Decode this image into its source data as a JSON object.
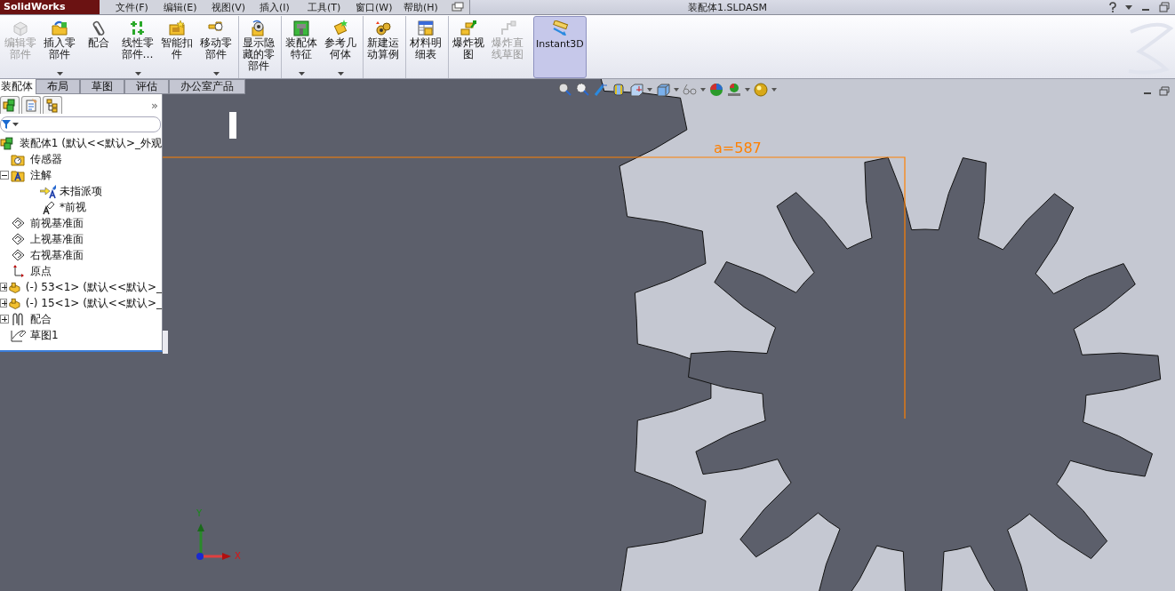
{
  "menu_bar": {
    "logo": "SolidWorks",
    "items": [
      "文件(F)",
      "编辑(E)",
      "视图(V)",
      "插入(I)",
      "工具(T)",
      "窗口(W)",
      "帮助(H)"
    ]
  },
  "window": {
    "title": "装配体1.SLDASM"
  },
  "command_manager": {
    "buttons": [
      {
        "label": "编辑零部件",
        "disabled": true,
        "dropdown": false,
        "selected": false,
        "separator_before": false
      },
      {
        "label": "插入零部件",
        "disabled": false,
        "dropdown": true,
        "selected": false,
        "separator_before": false
      },
      {
        "label": "配合",
        "disabled": false,
        "dropdown": false,
        "selected": false,
        "separator_before": false
      },
      {
        "label": "线性零部件…",
        "disabled": false,
        "dropdown": true,
        "selected": false,
        "separator_before": false
      },
      {
        "label": "智能扣件",
        "disabled": false,
        "dropdown": false,
        "selected": false,
        "separator_before": false
      },
      {
        "label": "移动零部件",
        "disabled": false,
        "dropdown": true,
        "selected": false,
        "separator_before": false
      },
      {
        "label": "显示隐藏的零部件",
        "disabled": false,
        "dropdown": false,
        "selected": false,
        "separator_before": true
      },
      {
        "label": "装配体特征",
        "disabled": false,
        "dropdown": true,
        "selected": false,
        "separator_before": true
      },
      {
        "label": "参考几何体",
        "disabled": false,
        "dropdown": true,
        "selected": false,
        "separator_before": false
      },
      {
        "label": "新建运动算例",
        "disabled": false,
        "dropdown": false,
        "selected": false,
        "separator_before": true
      },
      {
        "label": "材料明细表",
        "disabled": false,
        "dropdown": false,
        "selected": false,
        "separator_before": true
      },
      {
        "label": "爆炸视图",
        "disabled": false,
        "dropdown": false,
        "selected": false,
        "separator_before": true
      },
      {
        "label": "爆炸直线草图",
        "disabled": true,
        "dropdown": false,
        "selected": false,
        "separator_before": false
      },
      {
        "label": "Instant3D",
        "disabled": false,
        "dropdown": false,
        "selected": true,
        "separator_before": true
      }
    ]
  },
  "tabs": [
    {
      "label": "装配体",
      "selected": true
    },
    {
      "label": "布局",
      "selected": false
    },
    {
      "label": "草图",
      "selected": false
    },
    {
      "label": "评估",
      "selected": false
    },
    {
      "label": "办公室产品",
      "selected": false
    }
  ],
  "feature_manager": {
    "more": "»",
    "tree": [
      {
        "label": "装配体1 (默认<<默认>_外观",
        "kind": "assembly",
        "children": [
          {
            "label": "传感器",
            "kind": "sensor"
          },
          {
            "label": "注解",
            "kind": "annotations",
            "expanded": true,
            "children": [
              {
                "label": "未指派项",
                "kind": "annotation-arrow"
              },
              {
                "label": "*前视",
                "kind": "annotation"
              }
            ]
          },
          {
            "label": "前视基准面",
            "kind": "plane"
          },
          {
            "label": "上视基准面",
            "kind": "plane"
          },
          {
            "label": "右视基准面",
            "kind": "plane"
          },
          {
            "label": "原点",
            "kind": "origin"
          },
          {
            "label": "(-) 53<1> (默认<<默认>_",
            "kind": "part",
            "expanded": false
          },
          {
            "label": "(-) 15<1> (默认<<默认>_",
            "kind": "part",
            "expanded": false
          },
          {
            "label": "配合",
            "kind": "mates",
            "expanded": false
          },
          {
            "label": "草图1",
            "kind": "sketch"
          }
        ]
      }
    ]
  },
  "dimension": {
    "label": "a=587"
  },
  "triad": {
    "y_label": "Y",
    "x_label": "X"
  }
}
